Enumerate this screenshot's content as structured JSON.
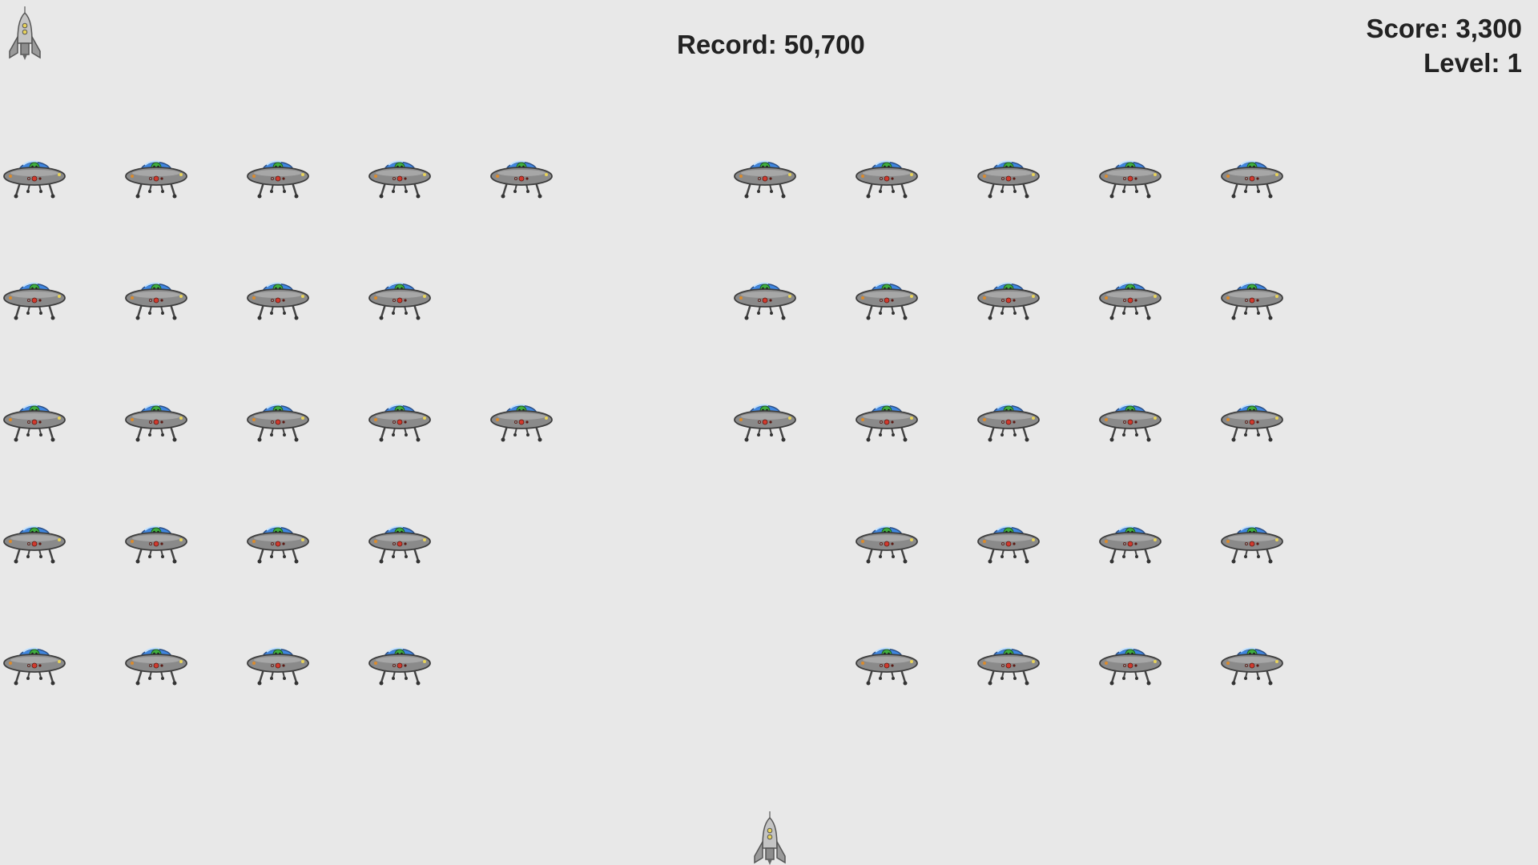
{
  "hud": {
    "record_label": "Record: 50,700",
    "score_label": "Score: 3,300",
    "level_label": "Level: 1"
  },
  "player": {
    "icon": "rocket-icon",
    "lives_icon": "rocket-icon"
  },
  "enemies": {
    "icon": "ufo-alien-icon",
    "rows": [
      [
        1,
        1,
        1,
        1,
        1,
        0,
        1,
        1,
        1,
        1,
        1
      ],
      [
        1,
        1,
        1,
        1,
        0,
        0,
        1,
        1,
        1,
        1,
        1
      ],
      [
        1,
        1,
        1,
        1,
        1,
        0,
        1,
        1,
        1,
        1,
        1
      ],
      [
        1,
        1,
        1,
        1,
        0,
        0,
        0,
        1,
        1,
        1,
        1
      ],
      [
        1,
        1,
        1,
        1,
        0,
        0,
        0,
        1,
        1,
        1,
        1
      ]
    ]
  },
  "colors": {
    "background": "#e8e8e8",
    "text": "#222222",
    "ufo_body": "#8a8a8a",
    "ufo_dome": "#3f86e0",
    "alien": "#3fae3f",
    "rocket_body": "#b5b5b5"
  }
}
